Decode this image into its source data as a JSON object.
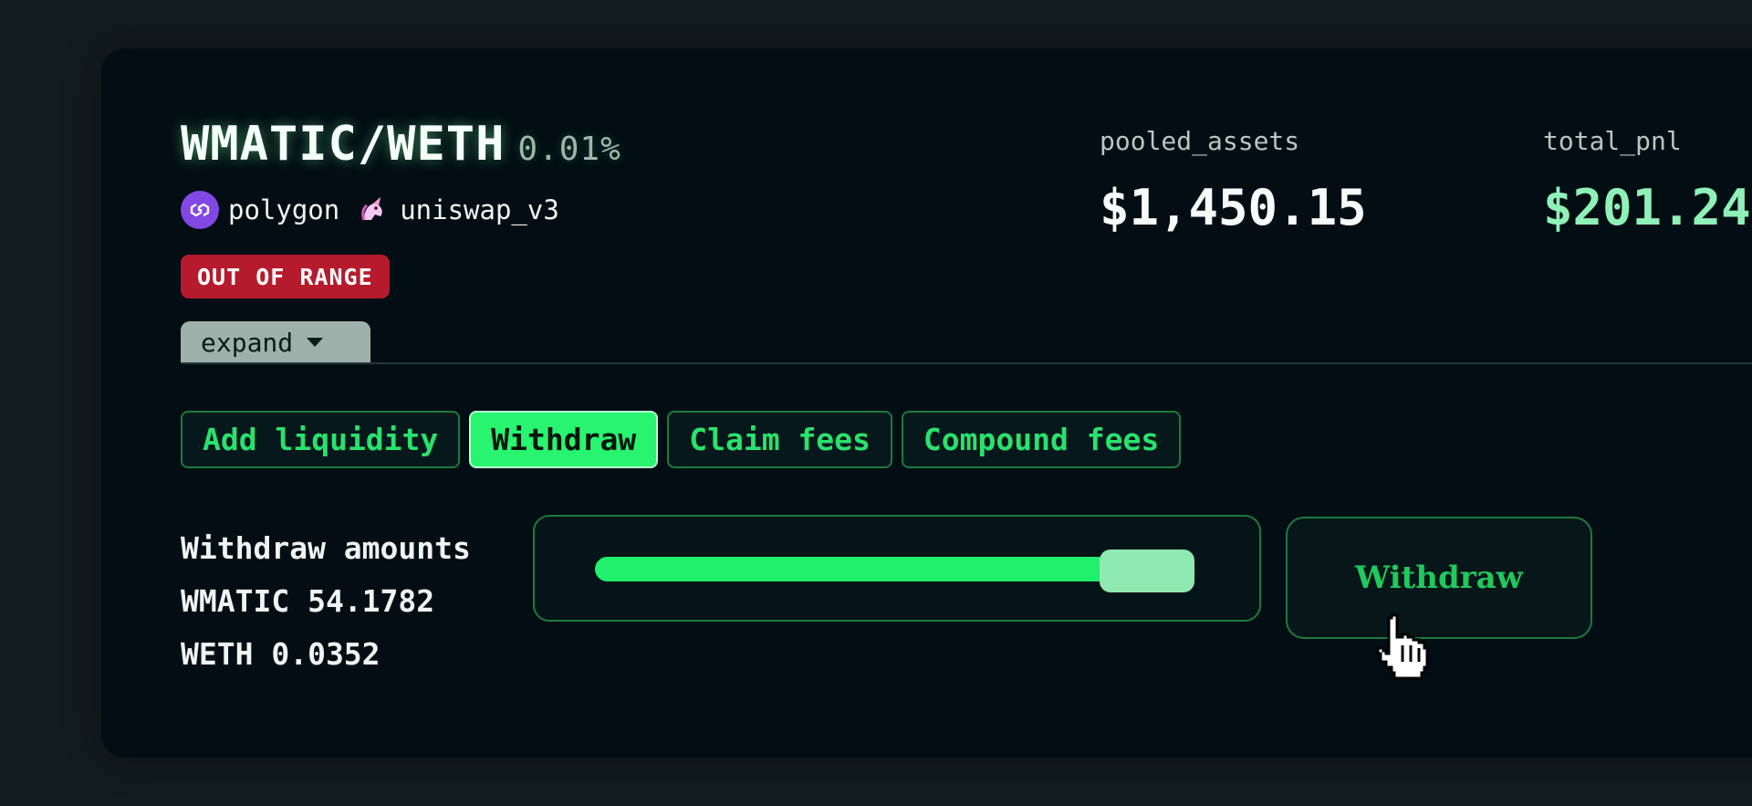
{
  "position": {
    "pair": "WMATIC/WETH",
    "fee_tier": "0.01%",
    "chain": "polygon",
    "dex": "uniswap_v3",
    "status": "OUT OF RANGE",
    "expand_label": "expand"
  },
  "stats": {
    "pooled_assets_label": "pooled_assets",
    "pooled_assets_value": "$1,450.15",
    "total_pnl_label": "total_pnl",
    "total_pnl_value": "$201.24"
  },
  "tabs": [
    {
      "label": "Add liquidity",
      "active": false
    },
    {
      "label": "Withdraw",
      "active": true
    },
    {
      "label": "Claim fees",
      "active": false
    },
    {
      "label": "Compound fees",
      "active": false
    }
  ],
  "withdraw": {
    "heading": "Withdraw amounts",
    "token0_amount": "WMATIC 54.1782",
    "token1_amount": "WETH 0.0352",
    "slider_fraction": 0.92,
    "button_label": "Withdraw"
  },
  "colors": {
    "accent_green": "#20f06c",
    "pnl_green": "#8ff0b8",
    "status_red": "#b51b2c",
    "polygon_purple": "#8247e5"
  }
}
